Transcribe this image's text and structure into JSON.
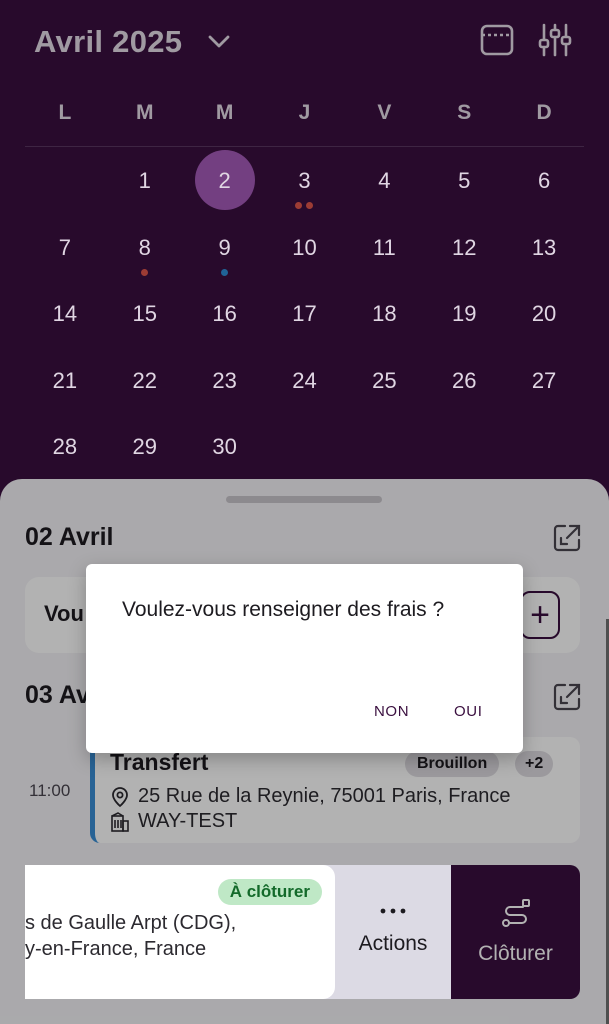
{
  "calendar": {
    "month_label": "Avril 2025",
    "weekdays": [
      "L",
      "M",
      "M",
      "J",
      "V",
      "S",
      "D"
    ],
    "days": [
      "1",
      "2",
      "3",
      "4",
      "5",
      "6",
      "7",
      "8",
      "9",
      "10",
      "11",
      "12",
      "13",
      "14",
      "15",
      "16",
      "17",
      "18",
      "19",
      "20",
      "21",
      "22",
      "23",
      "24",
      "25",
      "26",
      "27",
      "28",
      "29",
      "30"
    ],
    "selected_day": "2",
    "event_markers": {
      "3": [
        "#e0574b",
        "#e0574b"
      ],
      "8": [
        "#e0574b"
      ],
      "9": [
        "#2f8fd8"
      ]
    },
    "selected_color": "#a55bb9"
  },
  "header_icons": {
    "view_toggle": "calendar-view-icon",
    "filters": "sliders-filter-icon"
  },
  "sheet": {
    "day1_title": "02 Avril",
    "prompt_text": "Vou",
    "day2_title": "03 Av",
    "event": {
      "time": "11:00",
      "title": "Transfert",
      "status": "Brouillon",
      "extra_count": "+2",
      "address": "25 Rue de la Reynie, 75001 Paris, France",
      "client": "WAY-TEST",
      "accent": "#3a8fd6"
    },
    "swipe_event": {
      "status": "À clôturer",
      "line1": "s de Gaulle Arpt (CDG),",
      "line2": "y-en-France, France"
    },
    "actions_label": "Actions",
    "close_label": "Clôturer"
  },
  "dialog": {
    "message": "Voulez-vous renseigner des frais ?",
    "no_label": "NON",
    "yes_label": "OUI"
  },
  "colors": {
    "brand": "#3a0f3f",
    "success_bg": "#bfe8c6",
    "success_text": "#136a2a"
  }
}
